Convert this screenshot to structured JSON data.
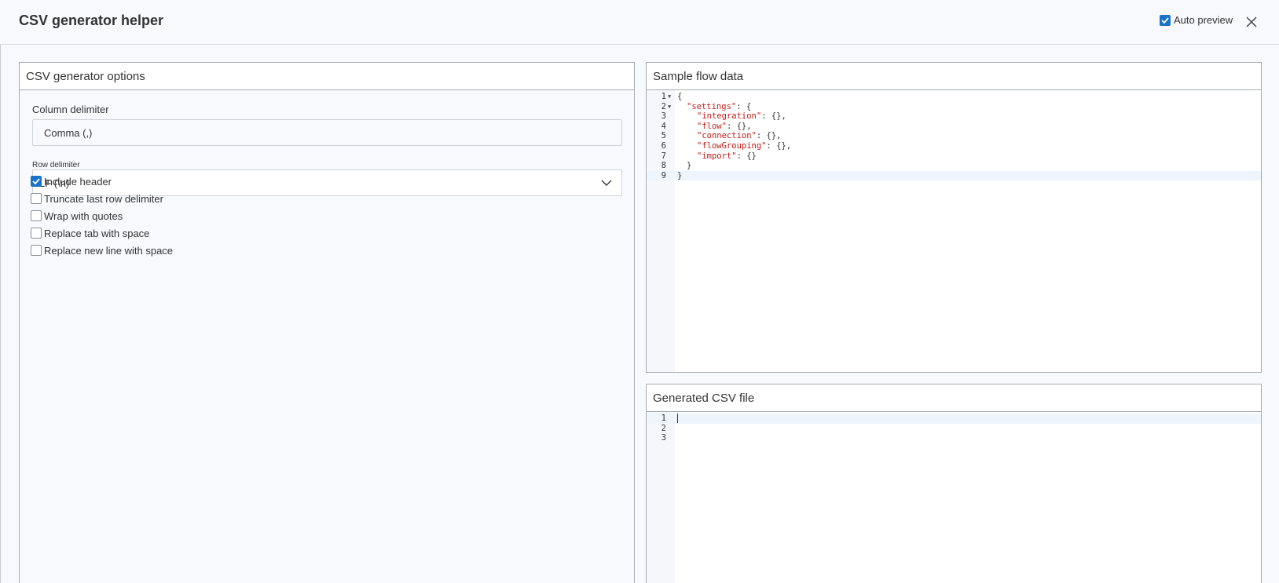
{
  "dialog": {
    "title": "CSV generator helper",
    "auto_preview_label": "Auto preview",
    "auto_preview_checked": true,
    "close_icon": "close-icon"
  },
  "options_panel": {
    "title": "CSV generator options",
    "column_delimiter_label": "Column delimiter",
    "column_delimiter_value": "Comma (,)",
    "row_delimiter_label": "Row delimiter",
    "row_delimiter_value": "LF (\\n)",
    "checkboxes": [
      {
        "label": "Include header",
        "checked": true
      },
      {
        "label": "Truncate last row delimiter",
        "checked": false
      },
      {
        "label": "Wrap with quotes",
        "checked": false
      },
      {
        "label": "Replace tab with space",
        "checked": false
      },
      {
        "label": "Replace new line with space",
        "checked": false
      }
    ]
  },
  "sample_panel": {
    "title": "Sample flow data",
    "lines": [
      {
        "n": "1",
        "fold": true,
        "text": "{"
      },
      {
        "n": "2",
        "fold": true,
        "key": "\"settings\"",
        "rest": ": {"
      },
      {
        "n": "3",
        "fold": false,
        "key": "\"integration\"",
        "rest": ": {},"
      },
      {
        "n": "4",
        "fold": false,
        "key": "\"flow\"",
        "rest": ": {},"
      },
      {
        "n": "5",
        "fold": false,
        "key": "\"connection\"",
        "rest": ": {},"
      },
      {
        "n": "6",
        "fold": false,
        "key": "\"flowGrouping\"",
        "rest": ": {},"
      },
      {
        "n": "7",
        "fold": false,
        "key": "\"import\"",
        "rest": ": {}"
      },
      {
        "n": "8",
        "fold": false,
        "text": "}"
      },
      {
        "n": "9",
        "fold": false,
        "text": "}"
      }
    ]
  },
  "generated_panel": {
    "title": "Generated CSV file",
    "lines": [
      "1",
      "2",
      "3"
    ]
  },
  "colors": {
    "accent": "#1a73c9",
    "json_key": "#c41a16"
  }
}
